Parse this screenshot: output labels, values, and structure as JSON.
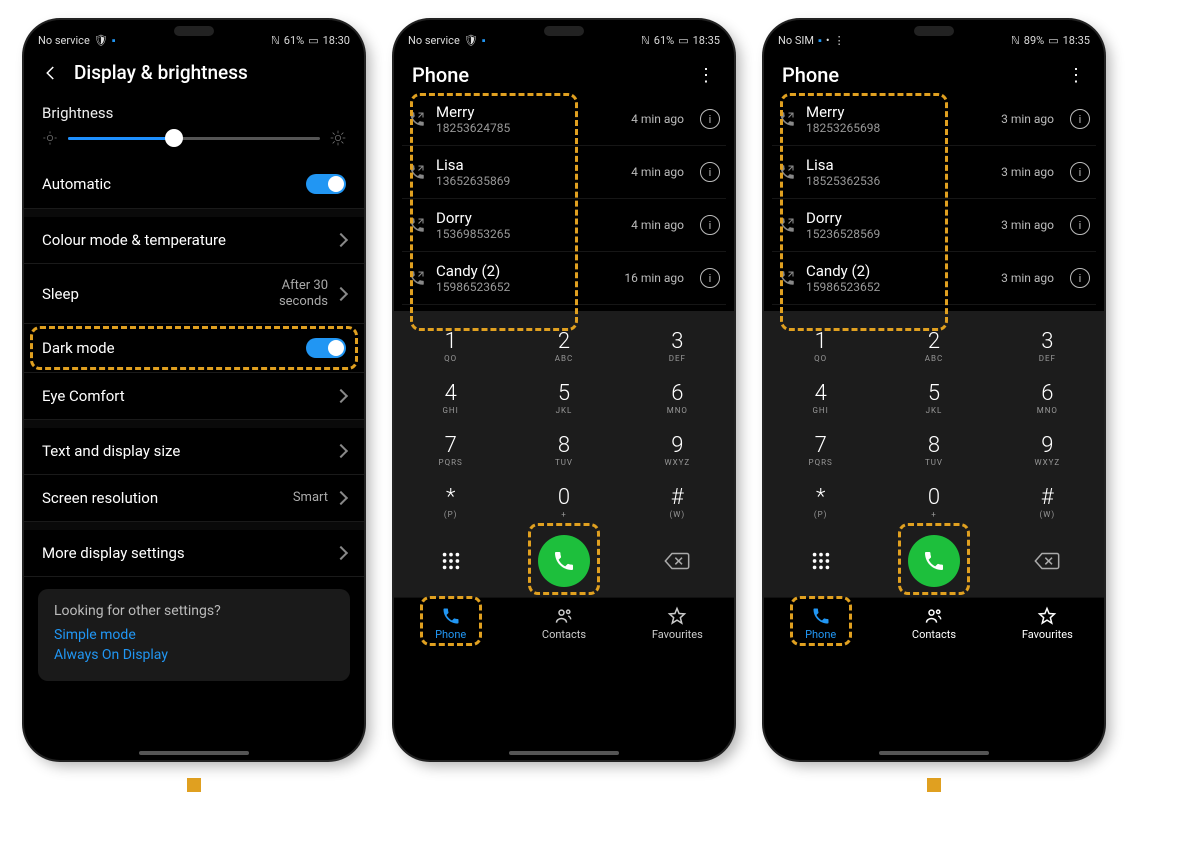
{
  "screen1": {
    "status": {
      "left": "No service",
      "battery": "61%",
      "time": "18:30"
    },
    "title": "Display & brightness",
    "brightness_label": "Brightness",
    "automatic_label": "Automatic",
    "rows": {
      "colour": "Colour mode & temperature",
      "sleep": "Sleep",
      "sleep_value": "After 30 seconds",
      "dark": "Dark mode",
      "eye": "Eye Comfort",
      "text": "Text and display size",
      "res": "Screen resolution",
      "res_value": "Smart",
      "more": "More display settings"
    },
    "card": {
      "q": "Looking for other settings?",
      "link1": "Simple mode",
      "link2": "Always On Display"
    }
  },
  "screen2": {
    "status": {
      "left": "No service",
      "battery": "61%",
      "time": "18:35"
    },
    "title": "Phone",
    "calls": [
      {
        "name": "Merry",
        "num": "18253624785",
        "time": "4 min ago"
      },
      {
        "name": "Lisa",
        "num": "13652635869",
        "time": "4 min ago"
      },
      {
        "name": "Dorry",
        "num": "15369853265",
        "time": "4 min ago"
      },
      {
        "name": "Candy (2)",
        "num": "15986523652",
        "time": "16 min ago"
      }
    ],
    "nav": {
      "phone": "Phone",
      "contacts": "Contacts",
      "fav": "Favourites"
    }
  },
  "screen3": {
    "status": {
      "left": "No SIM",
      "battery": "89%",
      "time": "18:35"
    },
    "title": "Phone",
    "calls": [
      {
        "name": "Merry",
        "num": "18253265698",
        "time": "3 min ago"
      },
      {
        "name": "Lisa",
        "num": "18525362536",
        "time": "3 min ago"
      },
      {
        "name": "Dorry",
        "num": "15236528569",
        "time": "3 min ago"
      },
      {
        "name": "Candy (2)",
        "num": "15986523652",
        "time": "3 min ago"
      }
    ],
    "nav": {
      "phone": "Phone",
      "contacts": "Contacts",
      "fav": "Favourites"
    }
  },
  "keypad": [
    {
      "d": "1",
      "s": "QO"
    },
    {
      "d": "2",
      "s": "ABC"
    },
    {
      "d": "3",
      "s": "DEF"
    },
    {
      "d": "4",
      "s": "GHI"
    },
    {
      "d": "5",
      "s": "JKL"
    },
    {
      "d": "6",
      "s": "MNO"
    },
    {
      "d": "7",
      "s": "PQRS"
    },
    {
      "d": "8",
      "s": "TUV"
    },
    {
      "d": "9",
      "s": "WXYZ"
    },
    {
      "d": "*",
      "s": "(P)"
    },
    {
      "d": "0",
      "s": "+"
    },
    {
      "d": "#",
      "s": "(W)"
    }
  ]
}
